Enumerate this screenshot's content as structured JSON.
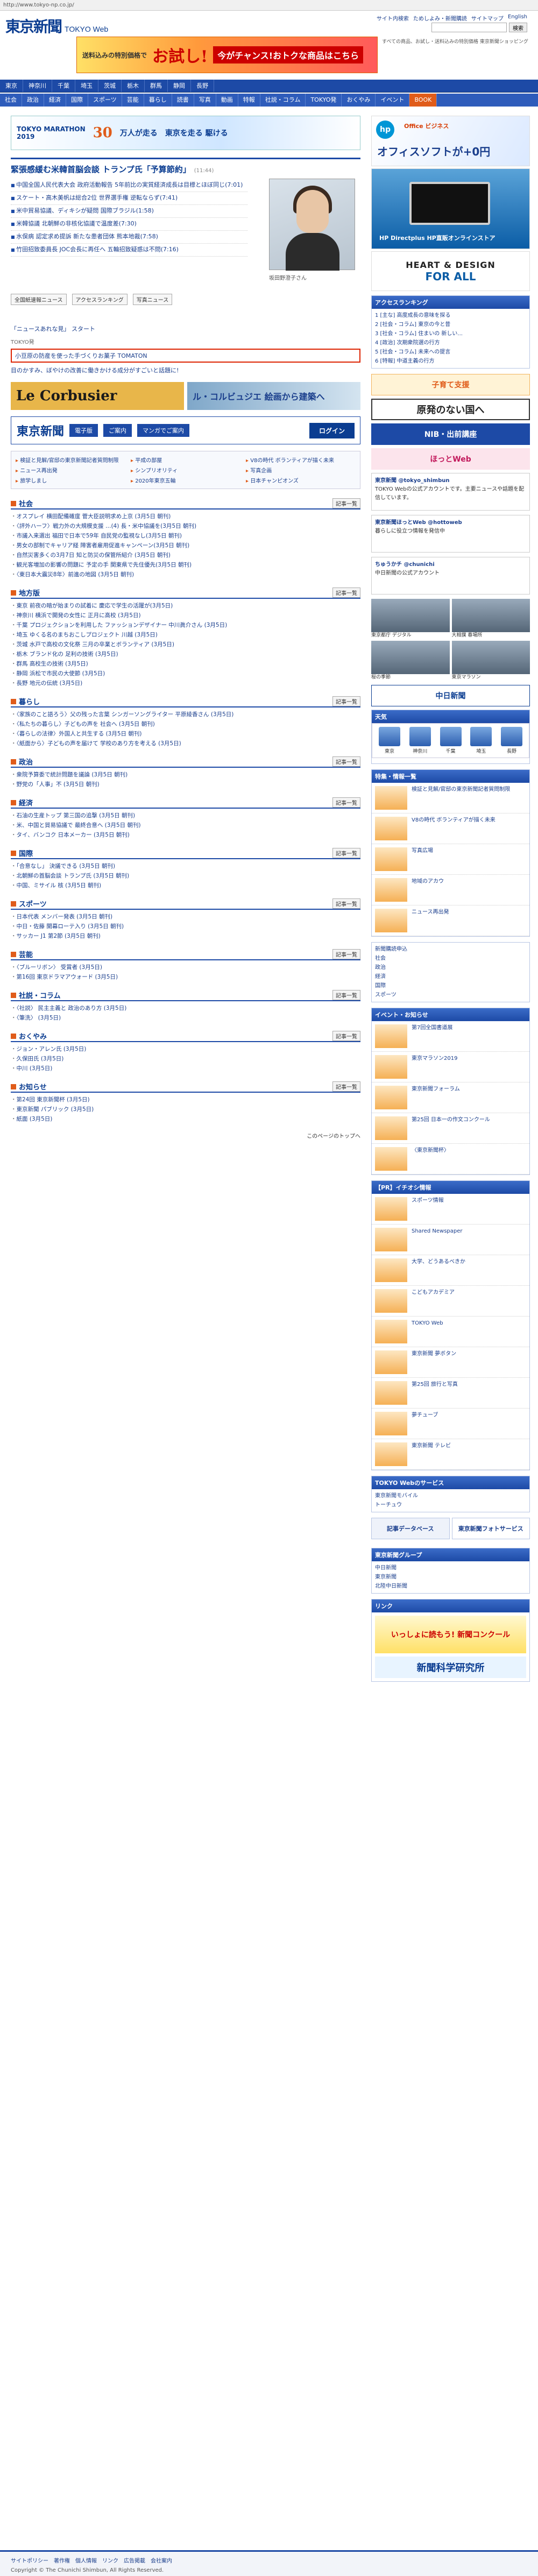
{
  "browser": {
    "url": "http://www.tokyo-np.co.jp/"
  },
  "header": {
    "logo": "東京新聞",
    "logo_sub": "TOKYO Web",
    "top_links": [
      "サイト内検索",
      "ためしよみ・新聞購読",
      "サイトマップ",
      "English"
    ],
    "search_placeholder": "",
    "search_button": "検索"
  },
  "ad_top": {
    "a": "送料込みの特別価格で",
    "b": "お試し!",
    "c": "今がチャンス!おトクな商品はこちら"
  },
  "ad_text": "すべての商品、お試し・送料込みの特別価格 東京新聞ショッピング",
  "nav": {
    "row1": [
      "東京",
      "神奈川",
      "千葉",
      "埼玉",
      "茨城",
      "栃木",
      "群馬",
      "静岡",
      "長野"
    ],
    "row2": [
      "社会",
      "政治",
      "経済",
      "国際",
      "スポーツ",
      "芸能",
      "暮らし",
      "読書",
      "写真",
      "動画",
      "特報",
      "社説・コラム",
      "TOKYO発",
      "おくやみ",
      "イベント",
      "BOOK"
    ]
  },
  "marathon": {
    "a": "TOKYO MARATHON",
    "b": "2019",
    "c": "30",
    "d": "万人が走る",
    "e": "東京を走る 駆ける"
  },
  "topnews": {
    "title": "緊張感緩む米韓首脳会談 トランプ氏「予算節約」",
    "time": "(11:44)",
    "items": [
      "中国全国人民代表大会 政府活動報告 5年前比の実質経済成長は目標とほぼ同じ(7:01)",
      "スケート・高木美帆は総合2位 世界選手権 逆転ならず(7:41)",
      "米中貿易協議、ディキシが疑問 国際ブラジル(1:58)",
      "米韓協議 北朝鮮の非核化協議で温度差(7:30)",
      "水俣病 認定求め提訴 新たな患者団体 熊本地裁(7:58)",
      "竹田招致委員長 JOC会長に再任へ 五輪招致疑惑は不問(7:16)"
    ],
    "photo_caption": "坂田野澄子さん",
    "btn1": "全国紙速報ニュース",
    "btn2": "アクセスランキング",
    "btn3": "写真ニュース"
  },
  "ikiru": {
    "l1": "「ニュースあれな見」 スタート",
    "label": "TOKYO発",
    "red": "小豆原の防産を使った手づくりお菓子 TOMATON",
    "l2": "目のかすみ、ぼやけの改善に働きかける成分がすごいと話題に!"
  },
  "lecorbusier": {
    "a": "Le Corbusier",
    "b": "ル・コルビュジエ 絵画から建築へ"
  },
  "denshi": {
    "a": "東京新聞",
    "b": "電子版",
    "c": "ご案内",
    "d": "マンガでご案内",
    "e": "ログイン"
  },
  "specials": [
    "検証と見解/官邸の東京新聞記者質問制限",
    "平成の部屋",
    "V8の時代 ボランティアが描く未来",
    "ニュース再出発",
    "シンプリオリティ",
    "写真企画",
    "旅学しまし",
    "2020年東京五輪",
    "日本チャンピオンズ"
  ],
  "sections": [
    {
      "name": "社会",
      "more": "記事一覧",
      "items": [
        "オスプレイ 横田配備確度 菅大臣説明求め上京 (3月5日 朝刊)",
        "〈評外ハーフ〉戦力外の大規模支援 …(4) 長・米中協議を(3月5日 朝刊)",
        "市議入来選出 福田で日本で59年 自民党の監視なし(3月5日 朝刊)",
        "男女の部制でキャリア経 障害者雇用促進キャンペーン(3月5日 朝刊)",
        "自然災害多くの3月7日 知と防災の保管所紹介 (3月5日 朝刊)",
        "観光客増加の影響の問題に 予定の手 関東県で先住優先(3月5日 朝刊)",
        "〈東日本大震災8年〉前進の地図 (3月5日 朝刊)"
      ]
    },
    {
      "name": "地方版",
      "more": "記事一覧",
      "items": [
        "東京 前夜の暗が始まりの試着に 慶応で学生の活躍が(3月5日)",
        "神奈川 横浜で開発の女性に 正月に高校 (3月5日)",
        "千葉 プロジェクションを利用した ファッションデザイナー 中川眞介さん (3月5日)",
        "埼玉 ゆくる名のまちおこしプロジェクト 川越 (3月5日)",
        "茨城 水戸で高校の文化祭 三月の卒業とボランティア (3月5日)",
        "栃木 ブランド化の 足利の技術 (3月5日)",
        "群馬 高校生の技術 (3月5日)",
        "静岡 浜松で市民の大使節 (3月5日)",
        "長野 地元の伝統 (3月5日)"
      ]
    },
    {
      "name": "暮らし",
      "more": "記事一覧",
      "items": [
        "〈家族のこと語ろう〉父の残った言葉 シンガーソングライター 平原綾香さん (3月5日)",
        "〈私たちの暮らし〉子どもの声を 社会へ (3月5日 朝刊)",
        "〈暮らしの法律〉外国人と共生する (3月5日 朝刊)",
        "〈紙面から〉子どもの声を届けて 学校のあり方を考える (3月5日)"
      ]
    },
    {
      "name": "政治",
      "more": "記事一覧",
      "items": [
        "衆院予算委で統計問題を議論 (3月5日 朝刊)",
        "野党の「人事」不 (3月5日 朝刊)"
      ]
    },
    {
      "name": "経済",
      "more": "記事一覧",
      "items": [
        "石油の生産トップ 第三国の追撃 (3月5日 朝刊)",
        "米、中国と貿易協議で 最終合意へ (3月5日 朝刊)",
        "タイ、バンコク 日本メーカー (3月5日 朝刊)"
      ]
    },
    {
      "name": "国際",
      "more": "記事一覧",
      "items": [
        "「合意なし」 決議できる (3月5日 朝刊)",
        "北朝鮮の首脳会談 トランプ氏 (3月5日 朝刊)",
        "中国、ミサイル 核 (3月5日 朝刊)"
      ]
    },
    {
      "name": "スポーツ",
      "more": "記事一覧",
      "items": [
        "日本代表 メンバー発表 (3月5日 朝刊)",
        "中日・佐藤 開幕ローテ入り (3月5日 朝刊)",
        "サッカー J1 第2節 (3月5日 朝刊)"
      ]
    },
    {
      "name": "芸能",
      "more": "記事一覧",
      "items": [
        "〈ブルーリボン〉 受賞者 (3月5日)",
        "第16回 東京ドラマアウォード (3月5日)"
      ]
    },
    {
      "name": "社説・コラム",
      "more": "記事一覧",
      "items": [
        "〈社説〉 民主主義と 政治のあり方 (3月5日)",
        "〈筆洗〉 (3月5日)"
      ]
    },
    {
      "name": "おくやみ",
      "more": "記事一覧",
      "items": [
        "ジョン・アレン氏 (3月5日)",
        "久保田氏 (3月5日)",
        "中川 (3月5日)"
      ]
    },
    {
      "name": "お知らせ",
      "more": "記事一覧",
      "items": [
        "第24回 東京新聞杯 (3月5日)",
        "東京新聞 パブリック (3月5日)",
        "紙面 (3月5日)"
      ]
    }
  ],
  "toplink_back": "このページのトップへ",
  "sidebar": {
    "ad1": {
      "hp": "hp",
      "office": "Office ビジネス ",
      "big": "オフィスソフトが+0円"
    },
    "ad2": "HP Directplus HP直販オンラインストア",
    "ad3": {
      "h": "HEART & DESIGN",
      "f": "FOR ALL"
    },
    "ranking_title": "アクセスランキング",
    "ranking": [
      "1 [主な] 高度成長の意味を探る",
      "2 [社会・コラム] 東京の今と昔",
      "3 [社会・コラム] 住まいの 新しい...",
      "4 [政治] 次期衆院選の行方",
      "5 [社会・コラム] 未来への提言",
      "6 [特報] 中道主義の行方"
    ],
    "kodomo": "子育て支援",
    "gensuki": "原発のない国へ",
    "nib": "NIB・出前講座",
    "hotto": "ほっとWeb",
    "tw1": {
      "name": "東京新聞 @tokyo_shimbun",
      "text": "TOKYO Webの公式アカウントです。主要ニュースや話題を配信しています。"
    },
    "tw2": {
      "name": "東京新聞ほっとWeb @hottoweb",
      "text": "暮らしに役立つ情報を発信中"
    },
    "tw3": {
      "name": "ちゅうかチ @chunichi",
      "text": "中日新聞の公式アカウント"
    },
    "photo_caps": [
      "東京都庁 デジタル",
      "大相撲 春場所",
      "桜の季節",
      "東京マラソン"
    ],
    "chunichi": "中日新聞",
    "weather_title": "天気",
    "weather": [
      "東京",
      "神奈川",
      "千葉",
      "埼玉",
      "長野"
    ],
    "services_title": "特集・情報一覧",
    "services": [
      "検証と見解/官邸の東京新聞記者質問制限",
      "V8の時代 ボランティアが描く未来",
      "写真広場",
      "地域のアカウ",
      "ニュース再出発"
    ],
    "local_links": [
      "新聞購読申込",
      "社会",
      "政治",
      "経済",
      "国際",
      "スポーツ"
    ],
    "event_title": "イベント・お知らせ",
    "events": [
      "第7回全国書道展",
      "東京マラソン2019",
      "東京新聞フォーラム",
      "第25回 日本一の作文コンクール",
      "〈東京新聞杯〉"
    ],
    "iken_title": "【PR】イチオシ情報",
    "iken": [
      "スポーツ情報",
      "Shared Newspaper",
      "大学、どうあるべきか",
      "こどもアカデミア",
      "TOKYO Web",
      "東京新聞 夢ボタン",
      "第25回 旅行と写真",
      "夢チューブ",
      "東京新聞 テレビ"
    ],
    "tokyoweb_title": "TOKYO Webのサービス",
    "tokyoweb_links": [
      "東京新聞モバイル",
      "トーチュウ"
    ],
    "kiji_db": "記事データベース",
    "photo_service": "東京新聞フォトサービス",
    "sports_title": "東京新聞グループ",
    "sports_links": [
      "中日新聞",
      "東京新聞",
      "北陸中日新聞"
    ],
    "link_title": "リンク",
    "contest": "いっしょに読もう! 新聞コンクール",
    "kenkyu": "新聞科学研究所"
  },
  "footer": {
    "links": [
      "サイトポリシー",
      "著作権",
      "個人情報",
      "リンク",
      "広告掲載",
      "会社案内"
    ],
    "copy": "Copyright © The Chunichi Shimbun, All Rights Reserved."
  }
}
